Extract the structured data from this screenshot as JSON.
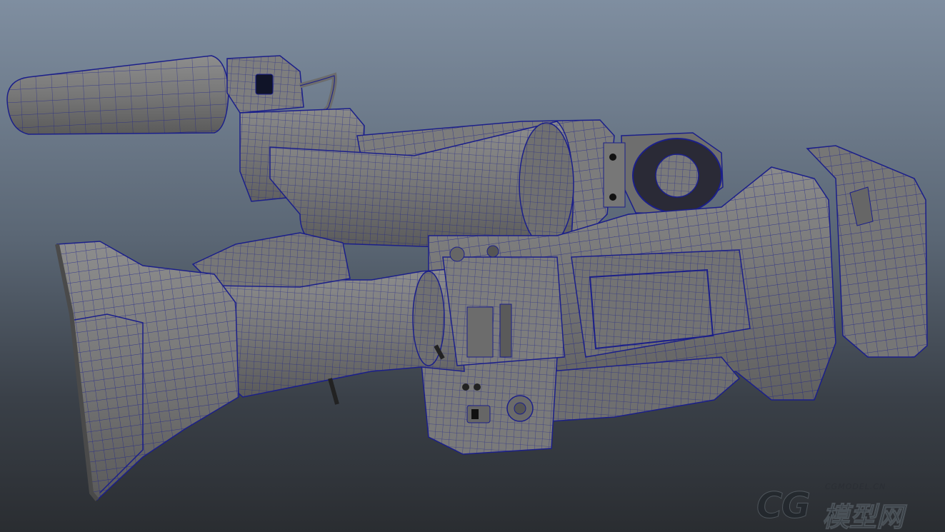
{
  "scene": {
    "subject": "camcorder-wireframe-model",
    "background_top": "#7f8ea0",
    "background_bottom": "#2a2d31",
    "surface_color": "#7a7a7a",
    "wire_color": "#1b1f8a"
  },
  "watermark": {
    "logo": "CG",
    "chinese": "模型网",
    "site": "CGMODEL.CN"
  }
}
